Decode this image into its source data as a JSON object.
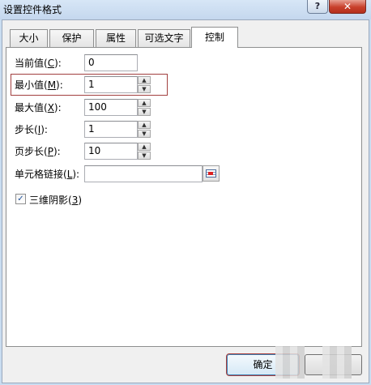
{
  "window": {
    "title": "设置控件格式",
    "help_glyph": "?",
    "close_glyph": "✕"
  },
  "tabs": [
    {
      "label": "大小"
    },
    {
      "label": "保护"
    },
    {
      "label": "属性"
    },
    {
      "label": "可选文字"
    },
    {
      "label": "控制"
    }
  ],
  "form": {
    "current": {
      "prefix": "当前值(",
      "key": "C",
      "suffix": "):",
      "value": "0"
    },
    "min": {
      "prefix": "最小值(",
      "key": "M",
      "suffix": "):",
      "value": "1"
    },
    "max": {
      "prefix": "最大值(",
      "key": "X",
      "suffix": "):",
      "value": "100"
    },
    "step": {
      "prefix": "步长(",
      "key": "I",
      "suffix": "):",
      "value": "1"
    },
    "page_step": {
      "prefix": "页步长(",
      "key": "P",
      "suffix": "):",
      "value": "10"
    },
    "cell_link": {
      "prefix": "单元格链接(",
      "key": "L",
      "suffix": "):",
      "value": ""
    },
    "shading_3d": {
      "prefix": "三维阴影(",
      "key": "3",
      "suffix": ")",
      "checked": true,
      "check_glyph": "✓"
    },
    "spin_up_glyph": "▲",
    "spin_down_glyph": "▼"
  },
  "buttons": {
    "ok_label": "确定"
  },
  "colors": {
    "highlight_border": "#a2403f",
    "dialog_bg": "#f0f0f0",
    "titlebar": "#c9dcf0"
  }
}
